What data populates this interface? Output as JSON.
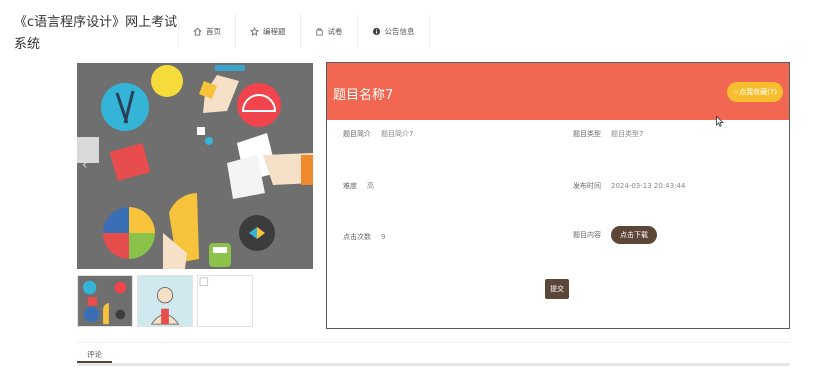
{
  "site": {
    "title": "《c语言程序设计》网上考试系统"
  },
  "nav": {
    "items": [
      {
        "label": "首页",
        "icon": "home-icon"
      },
      {
        "label": "编程题",
        "icon": "star-icon"
      },
      {
        "label": "试卷",
        "icon": "bag-icon"
      },
      {
        "label": "公告信息",
        "icon": "info-icon"
      }
    ]
  },
  "detail": {
    "title": "题目名称7",
    "fav_label": "☆点我收藏(7)",
    "fields": {
      "intro_label": "题目简介",
      "intro_value": "题目简介7",
      "type_label": "题目类型",
      "type_value": "题目类型7",
      "difficulty_label": "难度",
      "difficulty_value": "高",
      "publish_label": "发布时间",
      "publish_value": "2024-03-13 20:43:44",
      "clicks_label": "点击次数",
      "clicks_value": "9",
      "content_label": "题目内容",
      "download_label": "点击下载"
    },
    "submit_label": "提交"
  },
  "comments": {
    "tab_label": "评论"
  },
  "colors": {
    "header": "#f26751",
    "accent_brown": "#5c4637",
    "fav": "#f7bf2f"
  }
}
